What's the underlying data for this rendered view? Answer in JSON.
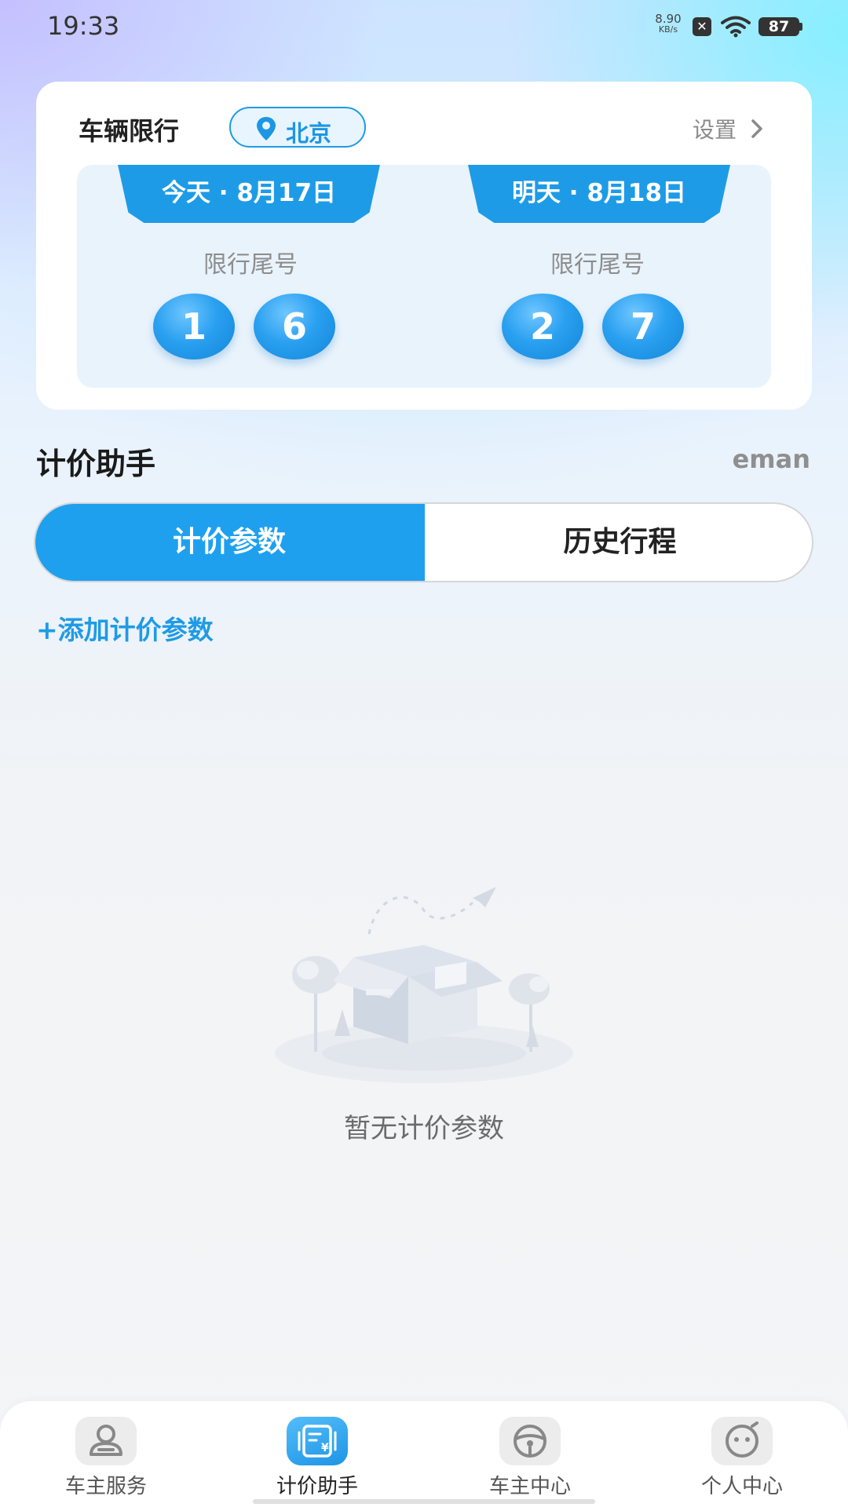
{
  "status_bar": {
    "time": "19:33",
    "net_speed_value": "8.90",
    "net_speed_unit": "KB/s",
    "battery": "87",
    "icons": [
      "close-box-icon",
      "wifi-icon",
      "battery-icon"
    ]
  },
  "restriction_card": {
    "title": "车辆限行",
    "city": "北京",
    "settings_label": "设置",
    "days": [
      {
        "tab": "今天 · 8月17日",
        "label": "限行尾号",
        "numbers": [
          "1",
          "6"
        ]
      },
      {
        "tab": "明天 · 8月18日",
        "label": "限行尾号",
        "numbers": [
          "2",
          "7"
        ]
      }
    ]
  },
  "pricing": {
    "title": "计价助手",
    "brand": "eman",
    "tabs": [
      {
        "label": "计价参数",
        "active": true
      },
      {
        "label": "历史行程",
        "active": false
      }
    ],
    "add_label": "+添加计价参数",
    "empty_text": "暂无计价参数"
  },
  "bottom_nav": {
    "items": [
      {
        "label": "车主服务",
        "icon": "person-icon",
        "active": false
      },
      {
        "label": "计价助手",
        "icon": "pricing-receipt-icon",
        "active": true
      },
      {
        "label": "车主中心",
        "icon": "steering-wheel-icon",
        "active": false
      },
      {
        "label": "个人中心",
        "icon": "smiley-face-icon",
        "active": false
      }
    ]
  },
  "colors": {
    "accent": "#1e9be6",
    "tab_active": "#1ea0ef",
    "text_dark": "#222222",
    "text_gray": "#8d8d8d"
  }
}
